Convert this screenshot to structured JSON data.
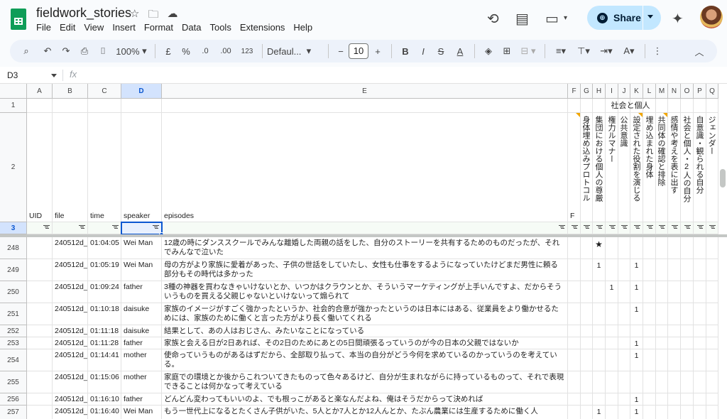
{
  "app": {
    "title": "fieldwork_stories",
    "menu": [
      "File",
      "Edit",
      "View",
      "Insert",
      "Format",
      "Data",
      "Tools",
      "Extensions",
      "Help"
    ],
    "share_label": "Share",
    "star_icon": "star-icon",
    "folder_icon": "move-folder-icon",
    "cloud_icon": "cloud-status-icon"
  },
  "toolbar": {
    "zoom": "100%",
    "currency": "£",
    "percent": "%",
    "dec_decrease": ".0",
    "dec_increase": ".00",
    "number_format": "123",
    "font": "Defaul...",
    "font_size": "10",
    "bold": "B",
    "italic": "I",
    "text_color": "A"
  },
  "formula_bar": {
    "name_box": "D3",
    "fx": "fx",
    "value": ""
  },
  "columns": [
    "A",
    "B",
    "C",
    "D",
    "E",
    "F",
    "G",
    "H",
    "I",
    "J",
    "K",
    "L",
    "M",
    "N",
    "O",
    "P",
    "Q"
  ],
  "selected_column": "D",
  "row1": {
    "group_header": "社会と個人"
  },
  "row2": {
    "F": "F",
    "G": "身体埋め込みプロトコル",
    "H": "集団における個人の尊厳",
    "I": "権力ルマナー",
    "J": "公共意識",
    "K": "設定された役割を演じる",
    "L": "埋め込まれた身体",
    "M": "共同体の確認と排除",
    "N": "感情や考えを表に出す",
    "O": "社会と個人・2人の自分",
    "P": "自意識・観られる自分",
    "Q": "ジェンダー"
  },
  "row2_headers": {
    "UID": "UID",
    "file": "file",
    "time": "time",
    "speaker": "speaker",
    "episodes": "episodes"
  },
  "row_numbers": {
    "r1": "1",
    "r2": "2",
    "r3": "3"
  },
  "rows": [
    {
      "num": "248",
      "file": "240512d_",
      "time": "01:04:05",
      "speaker": "Wei Man",
      "episode": "12歳の時にダンススクールでみんな離婚した両親の話をした、自分のストーリーを共有するためのものだったが、それでみんなで泣いた",
      "H": "★",
      "K": ""
    },
    {
      "num": "249",
      "file": "240512d_",
      "time": "01:05:19",
      "speaker": "Wei Man",
      "episode": "母の方がより家族に愛着があった、子供の世話をしていたし、女性も仕事をするようになっていたけどまだ男性に頼る部分もその時代は多かった",
      "H": "1",
      "K": "1"
    },
    {
      "num": "250",
      "file": "240512d_",
      "time": "01:09:24",
      "speaker": "father",
      "episode": "3種の神器を買わなきゃいけないとか、いつかはクラウンとか、そういうマーケティングが上手いんですよ、だからそういうものを買える父親じゃないといけないって煽られて",
      "I": "1",
      "K": "1"
    },
    {
      "num": "251",
      "file": "240512d_",
      "time": "01:10:18",
      "speaker": "daisuke",
      "episode": "家族のイメージがすごく強かったというか、社会的合意が強かったというのは日本にはある、従業員をより働かせるためには、家族のために働くと言った方がより長く働いてくれる",
      "K": "1"
    },
    {
      "num": "252",
      "file": "240512d_",
      "time": "01:11:18",
      "speaker": "daisuke",
      "episode": "結果として、あの人はおじさん、みたいなことになっている"
    },
    {
      "num": "253",
      "file": "240512d_",
      "time": "01:11:28",
      "speaker": "father",
      "episode": "家族と会える日が2日あれば、その2日のためにあとの5日間頑張るっていうのが今の日本の父親ではないか",
      "K": "1"
    },
    {
      "num": "254",
      "file": "240512d_",
      "time": "01:14:41",
      "speaker": "mother",
      "episode": "使命っていうものがあるはずだから、全部取り払って、本当の自分がどう今何を求めているのかっていうのを考えている。",
      "K": "1"
    },
    {
      "num": "255",
      "file": "240512d_",
      "time": "01:15:06",
      "speaker": "mother",
      "episode": "家庭での環境とか後からこれついてきたものって色々あるけど、自分が生まれながらに持っているものって、それで表現できることは何かなって考えている"
    },
    {
      "num": "256",
      "file": "240512d_",
      "time": "01:16:10",
      "speaker": "father",
      "episode": "どんどん変わってもいいのよ、でも根っこがあると楽なんだよね、俺はそうだからって決めれば",
      "K": "1"
    },
    {
      "num": "257",
      "file": "240512d_",
      "time": "01:16:40",
      "speaker": "Wei Man",
      "episode": "もう一世代上になるとたくさん子供がいた、5人とか7人とか12人んとか、たぶん農業には生産するために働く人",
      "H": "1",
      "K": "1"
    }
  ]
}
